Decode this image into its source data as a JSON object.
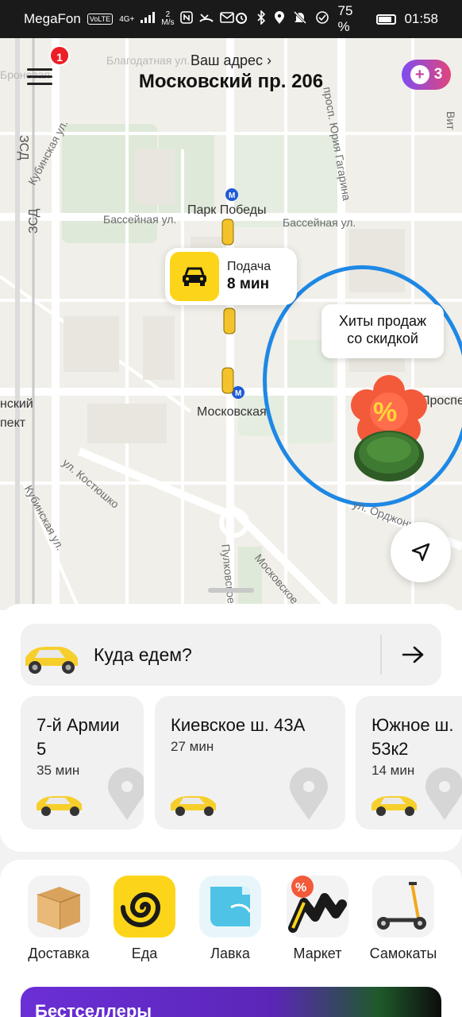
{
  "status_bar": {
    "carrier": "MegaFon",
    "volte": "VoLTE",
    "network": "4G+",
    "speed_value": "2",
    "speed_unit": "M/s",
    "battery": "75 %",
    "battery_level": 0.75,
    "time": "01:58"
  },
  "header": {
    "menu_badge": "1",
    "address_caption": "Ваш адрес ›",
    "address_value": "Московский пр. 206",
    "plus_count": "3"
  },
  "map": {
    "labels": {
      "metro_park": "Парк Победы",
      "basseinaya_left": "Бассейная ул.",
      "basseinaya_right": "Бассейная ул.",
      "metro_moskovskaya": "Московская",
      "kubinskaya_top": "Кубинская ул.",
      "kubinskaya_bottom": "Кубинская ул.",
      "kostyushko": "ул. Костюшко",
      "gagarina": "просп. Юрия Гагарина",
      "pulkovskoe": "Пулковское",
      "moskovskoe": "Московское",
      "ordzhonikidze": "ул. Орджоникидзе",
      "zsd_top": "ЗСД",
      "zsd_bottom": "ЗСД",
      "blagodatnaya": "Благодатная ул.",
      "left_cut_1": "нский",
      "left_cut_2": "пект",
      "prosp_cut": "Проспе",
      "vit_cut": "Вит",
      "bronev": "Броневая"
    },
    "pickup": {
      "label": "Подача",
      "time": "8 мин"
    },
    "promo_bubble": {
      "line1": "Хиты продаж",
      "line2": "со скидкой"
    }
  },
  "sheet": {
    "where_prompt": "Куда едем?",
    "destinations": [
      {
        "title": "7-й Армии 5",
        "time": "35 мин"
      },
      {
        "title": "Киевское ш. 43А",
        "time": "27 мин"
      },
      {
        "title": "Южное ш. 53к2",
        "time": "14 мин"
      }
    ],
    "services": [
      {
        "label": "Доставка",
        "icon": "box-icon"
      },
      {
        "label": "Еда",
        "icon": "spiral-icon"
      },
      {
        "label": "Лавка",
        "icon": "lavka-icon"
      },
      {
        "label": "Маркет",
        "icon": "market-icon"
      },
      {
        "label": "Самокаты",
        "icon": "scooter-icon"
      }
    ],
    "bestseller_label": "Бестселлеры"
  },
  "colors": {
    "yandex_yellow": "#fcd51a",
    "badge_red": "#ec1f26",
    "plus_gradient_start": "#7e4df2",
    "plus_gradient_end": "#e0457b",
    "annotation_blue": "#1e88e5"
  }
}
